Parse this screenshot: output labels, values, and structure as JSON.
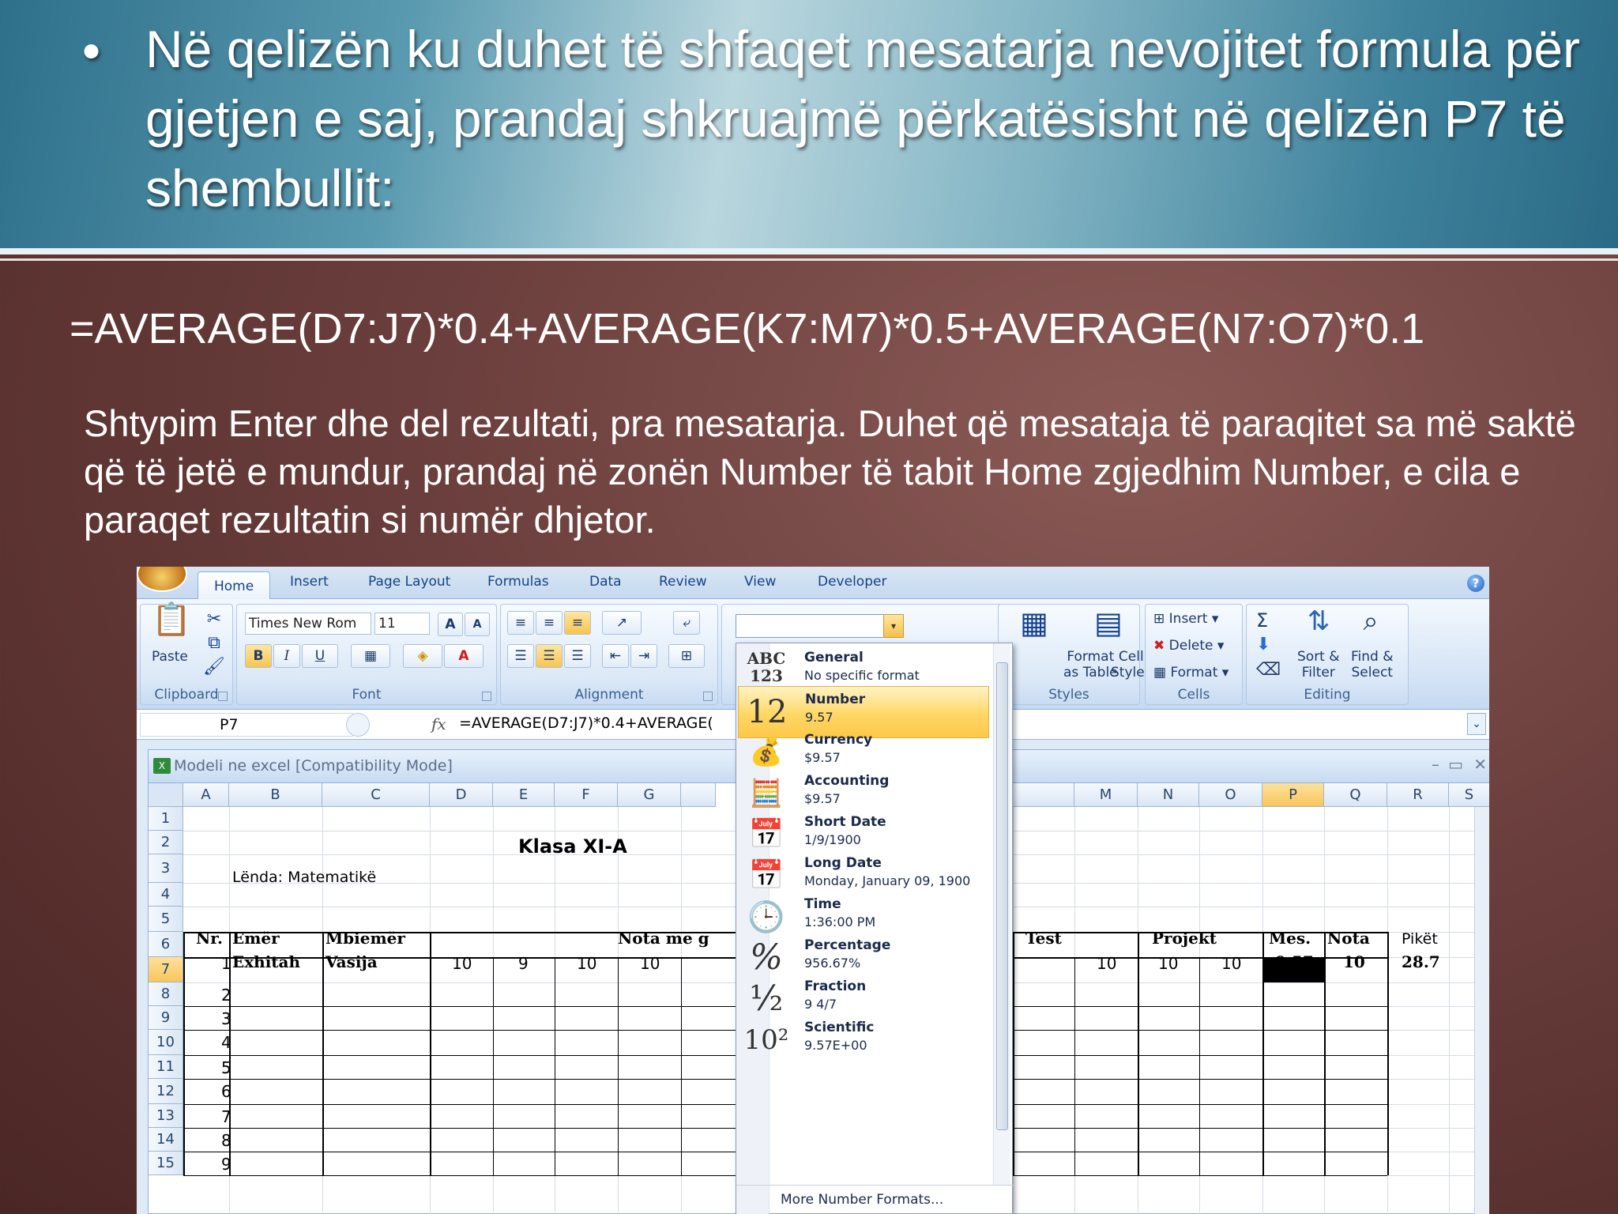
{
  "slide": {
    "bullet_symbol": "•",
    "bullet_text": "Në qelizën ku duhet të shfaqet mesatarja nevojitet formula për gjetjen e saj, prandaj shkruajmë përkatësisht në qelizën P7 të shembullit:",
    "formula": "=AVERAGE(D7:J7)*0.4+AVERAGE(K7:M7)*0.5+AVERAGE(N7:O7)*0.1",
    "body": "Shtypim Enter dhe del rezultati, pra mesatarja. Duhet që mesataja të paraqitet sa më saktë që të jetë e mundur, prandaj në zonën Number të tabit Home zgjedhim Number, e cila e paraqet rezultatin si numër dhjetor."
  },
  "excel": {
    "tabs": [
      "Home",
      "Insert",
      "Page Layout",
      "Formulas",
      "Data",
      "Review",
      "View",
      "Developer"
    ],
    "active_tab": "Home",
    "help": "?",
    "clipboard": {
      "paste": "Paste",
      "label": "Clipboard"
    },
    "font": {
      "name": "Times New Rom",
      "size": "11",
      "bold": "B",
      "italic": "I",
      "underline": "U",
      "grow": "A",
      "shrink": "A",
      "label": "Font"
    },
    "alignment": {
      "label": "Alignment"
    },
    "styles": {
      "format_table": "Format\nas Table",
      "cell_styles": "Cell\nStyles",
      "label": "Styles"
    },
    "cells": {
      "insert": "Insert",
      "delete": "Delete",
      "format": "Format",
      "label": "Cells"
    },
    "editing": {
      "sum": "Σ",
      "sort": "Sort &\nFilter",
      "find": "Find &\nSelect",
      "label": "Editing"
    },
    "name_box": "P7",
    "fx": "fx",
    "formula_bar": "=AVERAGE(D7:J7)*0.4+AVERAGE(",
    "workbook_title": "Modeli ne excel  [Compatibility Mode]",
    "wb_controls": [
      "–",
      "▭",
      "✕"
    ],
    "columns_left": [
      "A",
      "B",
      "C",
      "D",
      "E",
      "F",
      "G"
    ],
    "columns_right": [
      "M",
      "N",
      "O",
      "P",
      "Q",
      "R",
      "S"
    ],
    "rows": [
      "1",
      "2",
      "3",
      "4",
      "5",
      "6",
      "7",
      "8",
      "9",
      "10",
      "11",
      "12",
      "13",
      "14",
      "15"
    ],
    "sheet": {
      "title": "Klasa   XI-A",
      "subject": "Lënda: Matematikë",
      "headers": {
        "nr": "Nr.",
        "emer": "Emër",
        "mbiemer": "Mbiemër",
        "nota_me": "Nota  me g",
        "test": "Test",
        "projekt": "Projekt",
        "mes": "Mes.",
        "nota": "Nota",
        "piket": "Pikët"
      },
      "row7": {
        "nr": "1",
        "emer": "Exhitah",
        "mbiemer": "Vasija",
        "d": "10",
        "e": "9",
        "f": "10",
        "g": "10",
        "m": "10",
        "n": "10",
        "o": "10",
        "p": "9.57",
        "q": "10",
        "r": "28.7"
      },
      "nr_list": [
        "2",
        "3",
        "4",
        "5",
        "6",
        "7",
        "8",
        "9"
      ]
    },
    "number_formats": [
      {
        "name": "General",
        "sample": "No specific format",
        "icon": "ABC\n123"
      },
      {
        "name": "Number",
        "sample": "9.57",
        "icon": "12"
      },
      {
        "name": "Currency",
        "sample": "$9.57",
        "icon": "currency"
      },
      {
        "name": "Accounting",
        "sample": " $9.57",
        "icon": "accounting"
      },
      {
        "name": "Short Date",
        "sample": "1/9/1900",
        "icon": "calendar"
      },
      {
        "name": "Long Date",
        "sample": "Monday, January 09, 1900",
        "icon": "calendar"
      },
      {
        "name": "Time",
        "sample": "1:36:00 PM",
        "icon": "clock"
      },
      {
        "name": "Percentage",
        "sample": "956.67%",
        "icon": "%"
      },
      {
        "name": "Fraction",
        "sample": "9 4/7",
        "icon": "½"
      },
      {
        "name": "Scientific",
        "sample": "9.57E+00",
        "icon": "10²"
      }
    ],
    "more_formats": "More Number Formats..."
  }
}
